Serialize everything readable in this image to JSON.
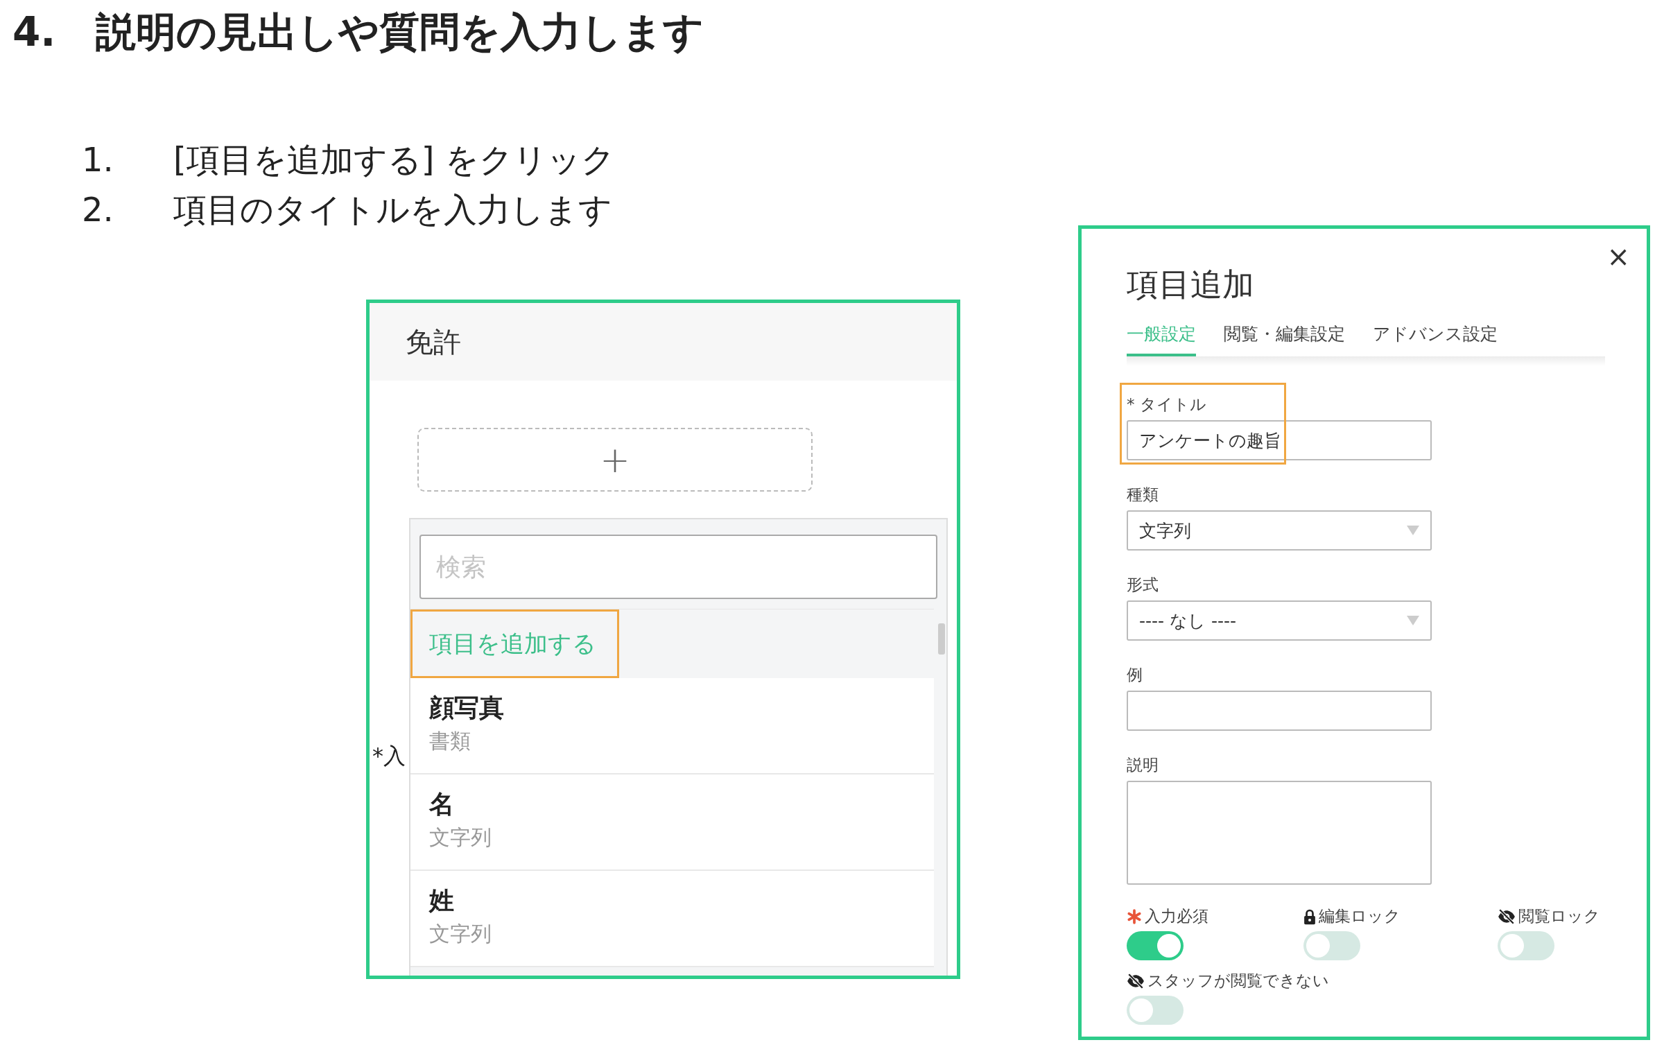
{
  "heading": {
    "number": "4.",
    "text": "説明の見出しや質問を入力します"
  },
  "steps": [
    {
      "number": "1.",
      "text": "[項目を追加する] をクリック"
    },
    {
      "number": "2.",
      "text": "項目のタイトルを入力します"
    }
  ],
  "left_screenshot": {
    "header": "免許",
    "add_button": "+",
    "background_fragment": "*入",
    "search": {
      "placeholder": "検索"
    },
    "items": [
      {
        "kind": "action",
        "label": "項目を追加する",
        "highlighted": true
      },
      {
        "kind": "field",
        "label": "顔写真",
        "type": "書類",
        "highlighted": false
      },
      {
        "kind": "field",
        "label": "名",
        "type": "文字列",
        "highlighted": false
      },
      {
        "kind": "field",
        "label": "姓",
        "type": "文字列",
        "highlighted": false
      }
    ]
  },
  "right_screenshot": {
    "close": "×",
    "title": "項目追加",
    "tabs": [
      {
        "label": "一般設定",
        "selected": true
      },
      {
        "label": "閲覧・編集設定",
        "selected": false
      },
      {
        "label": "アドバンス設定",
        "selected": false
      }
    ],
    "fields": [
      {
        "kind": "text",
        "label": "* タイトル",
        "value": "アンケートの趣旨",
        "highlighted": true
      },
      {
        "kind": "select",
        "label": "種類",
        "value": "文字列",
        "highlighted": false
      },
      {
        "kind": "select",
        "label": "形式",
        "value": "---- なし ----",
        "highlighted": false
      },
      {
        "kind": "text",
        "label": "例",
        "highlighted": false
      },
      {
        "kind": "textarea",
        "label": "説明",
        "highlighted": false
      }
    ],
    "toggles": [
      {
        "kind": "required",
        "label": "入力必須",
        "on": true
      },
      {
        "kind": "locked",
        "label": "編集ロック",
        "on": false
      },
      {
        "kind": "hidden",
        "label": "閲覧ロック",
        "on": false
      },
      {
        "kind": "hidden",
        "label": "スタッフが閲覧できない",
        "on": false
      }
    ]
  }
}
